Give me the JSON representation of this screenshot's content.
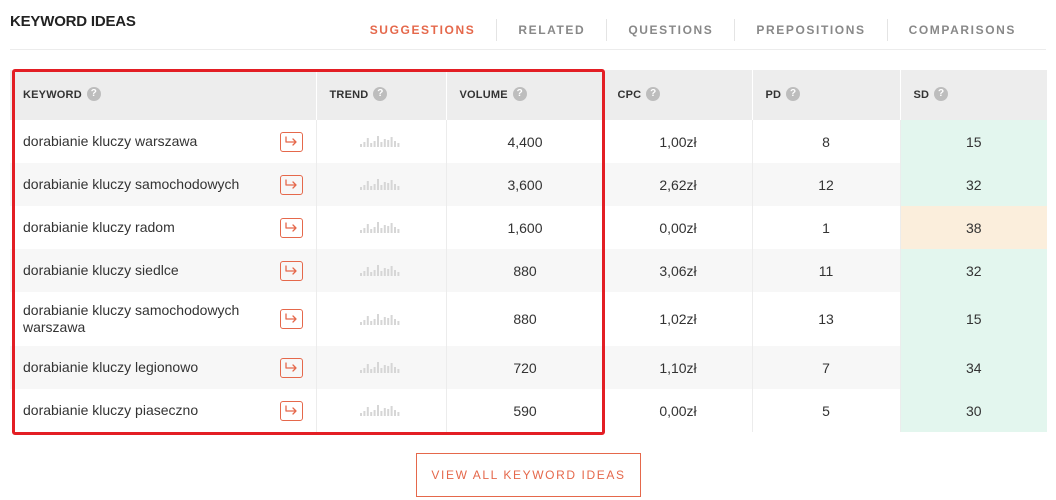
{
  "header": {
    "title": "KEYWORD IDEAS",
    "tabs": [
      {
        "label": "SUGGESTIONS",
        "active": true
      },
      {
        "label": "RELATED",
        "active": false
      },
      {
        "label": "QUESTIONS",
        "active": false
      },
      {
        "label": "PREPOSITIONS",
        "active": false
      },
      {
        "label": "COMPARISONS",
        "active": false
      }
    ]
  },
  "table": {
    "columns": [
      {
        "label": "KEYWORD",
        "help_icon": "?"
      },
      {
        "label": "TREND",
        "help_icon": "?"
      },
      {
        "label": "VOLUME",
        "help_icon": "?"
      },
      {
        "label": "CPC",
        "help_icon": "?"
      },
      {
        "label": "PD",
        "help_icon": "?"
      },
      {
        "label": "SD",
        "help_icon": "?"
      }
    ],
    "rows": [
      {
        "keyword": "dorabianie kluczy warszawa",
        "volume": "4,400",
        "cpc": "1,00zł",
        "pd": "8",
        "sd": "15",
        "sd_level": "green"
      },
      {
        "keyword": "dorabianie kluczy samochodowych",
        "volume": "3,600",
        "cpc": "2,62zł",
        "pd": "12",
        "sd": "32",
        "sd_level": "green"
      },
      {
        "keyword": "dorabianie kluczy radom",
        "volume": "1,600",
        "cpc": "0,00zł",
        "pd": "1",
        "sd": "38",
        "sd_level": "orange"
      },
      {
        "keyword": "dorabianie kluczy siedlce",
        "volume": "880",
        "cpc": "3,06zł",
        "pd": "11",
        "sd": "32",
        "sd_level": "green"
      },
      {
        "keyword": "dorabianie kluczy samochodowych warszawa",
        "volume": "880",
        "cpc": "1,02zł",
        "pd": "13",
        "sd": "15",
        "sd_level": "green"
      },
      {
        "keyword": "dorabianie kluczy legionowo",
        "volume": "720",
        "cpc": "1,10zł",
        "pd": "7",
        "sd": "34",
        "sd_level": "green"
      },
      {
        "keyword": "dorabianie kluczy piaseczno",
        "volume": "590",
        "cpc": "0,00zł",
        "pd": "5",
        "sd": "30",
        "sd_level": "green"
      }
    ],
    "row_action_icon": "arrow-corner-right-icon",
    "trend_icon": "sparkline-bars-icon"
  },
  "footer": {
    "view_all_label": "VIEW ALL KEYWORD IDEAS"
  },
  "colors": {
    "accent": "#e5684b",
    "highlight_border": "#e31e24",
    "sd_green": "#e3f6ee",
    "sd_orange": "#fbeedc"
  }
}
